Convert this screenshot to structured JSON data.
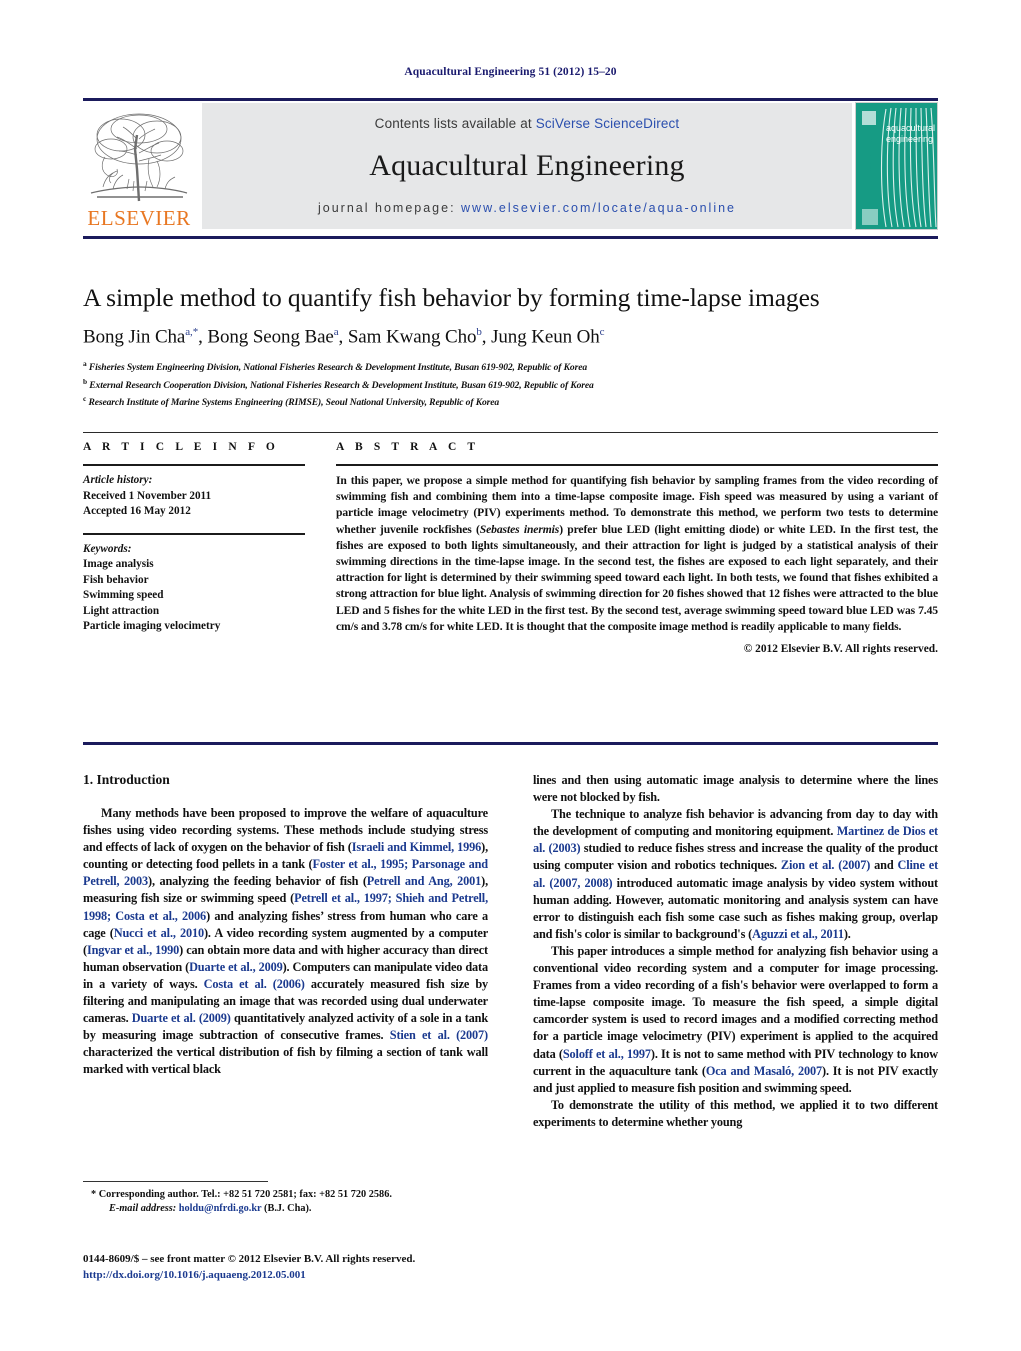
{
  "running_head": "Aquacultural Engineering 51 (2012) 15–20",
  "masthead": {
    "publisher_logo_text": "ELSEVIER",
    "contents_prefix": "Contents lists available at ",
    "contents_link": "SciVerse ScienceDirect",
    "journal_title": "Aquacultural Engineering",
    "homepage_prefix": "journal homepage: ",
    "homepage_url": "www.elsevier.com/locate/aqua-online",
    "cover_title_line1": "aquacultural",
    "cover_title_line2": "engineering",
    "cover_color": "#169b84",
    "link_color": "#2b4fae",
    "logo_color": "#e87722"
  },
  "article": {
    "title": "A simple method to quantify fish behavior by forming time-lapse images",
    "authors": [
      {
        "name": "Bong Jin Cha",
        "marks": "a,*"
      },
      {
        "name": "Bong Seong Bae",
        "marks": "a"
      },
      {
        "name": "Sam Kwang Cho",
        "marks": "b"
      },
      {
        "name": "Jung Keun Oh",
        "marks": "c"
      }
    ],
    "affiliations": [
      {
        "mark": "a",
        "text": "Fisheries System Engineering Division, National Fisheries Research & Development Institute, Busan 619-902, Republic of Korea"
      },
      {
        "mark": "b",
        "text": "External Research Cooperation Division, National Fisheries Research & Development Institute, Busan 619-902, Republic of Korea"
      },
      {
        "mark": "c",
        "text": "Research Institute of Marine Systems Engineering (RIMSE), Seoul National University, Republic of Korea"
      }
    ]
  },
  "article_info": {
    "heading": "A R T I C L E   I N F O",
    "history_label": "Article history:",
    "history": [
      "Received 1 November 2011",
      "Accepted 16 May 2012"
    ],
    "keywords_label": "Keywords:",
    "keywords": [
      "Image analysis",
      "Fish behavior",
      "Swimming speed",
      "Light attraction",
      "Particle imaging velocimetry"
    ]
  },
  "abstract": {
    "heading": "A B S T R A C T",
    "part1": "In this paper, we propose a simple method for quantifying fish behavior by sampling frames from the video recording of swimming fish and combining them into a time-lapse composite image. Fish speed was measured by using a variant of particle image velocimetry (PIV) experiments method. To demonstrate this method, we perform two tests to determine whether juvenile rockfishes (",
    "species": "Sebastes inermis",
    "part2": ") prefer blue LED (light emitting diode) or white LED. In the first test, the fishes are exposed to both lights simultaneously, and their attraction for light is judged by a statistical analysis of their swimming directions in the time-lapse image. In the second test, the fishes are exposed to each light separately, and their attraction for light is determined by their swimming speed toward each light. In both tests, we found that fishes exhibited a strong attraction for blue light. Analysis of swimming direction for 20 fishes showed that 12 fishes were attracted to the blue LED and 5 fishes for the white LED in the first test. By the second test, average swimming speed toward blue LED was 7.45 cm/s and 3.78 cm/s for white LED. It is thought that the composite image method is readily applicable to many fields.",
    "copyright": "© 2012 Elsevier B.V. All rights reserved."
  },
  "body": {
    "section_heading": "1.  Introduction",
    "left_paragraph_1": {
      "segments": [
        {
          "t": "Many methods have been proposed to improve the welfare of aquaculture fishes using video recording systems. These methods include studying stress and effects of lack of oxygen on the behavior of fish (",
          "ref": false
        },
        {
          "t": "Israeli and Kimmel, 1996",
          "ref": true
        },
        {
          "t": "), counting or detecting food pellets in a tank (",
          "ref": false
        },
        {
          "t": "Foster et al., 1995; Parsonage and Petrell, 2003",
          "ref": true
        },
        {
          "t": "), analyzing the feeding behavior of fish (",
          "ref": false
        },
        {
          "t": "Petrell and Ang, 2001",
          "ref": true
        },
        {
          "t": "), measuring fish size or swimming speed (",
          "ref": false
        },
        {
          "t": "Petrell et al., 1997; Shieh and Petrell, 1998; Costa et al., 2006",
          "ref": true
        },
        {
          "t": ") and analyzing fishes’ stress from human who care a cage (",
          "ref": false
        },
        {
          "t": "Nucci et al., 2010",
          "ref": true
        },
        {
          "t": "). A video recording system augmented by a computer (",
          "ref": false
        },
        {
          "t": "Ingvar et al., 1990",
          "ref": true
        },
        {
          "t": ") can obtain more data and with higher accuracy than direct human observation (",
          "ref": false
        },
        {
          "t": "Duarte et al., 2009",
          "ref": true
        },
        {
          "t": "). Computers can manipulate video data in a variety of ways. ",
          "ref": false
        },
        {
          "t": "Costa et al. (2006)",
          "ref": true
        },
        {
          "t": " accurately measured fish size by filtering and manipulating an image that was recorded using dual underwater cameras. ",
          "ref": false
        },
        {
          "t": "Duarte et al. (2009)",
          "ref": true
        },
        {
          "t": " quantitatively analyzed activity of a sole in a tank by measuring image subtraction of consecutive frames. ",
          "ref": false
        },
        {
          "t": "Stien et al. (2007)",
          "ref": true
        },
        {
          "t": " characterized the vertical distribution of fish by filming a section of tank wall marked with vertical black",
          "ref": false
        }
      ]
    },
    "right_paragraph_1": {
      "segments": [
        {
          "t": "lines and then using automatic image analysis to determine where the lines were not blocked by fish.",
          "ref": false
        }
      ]
    },
    "right_paragraph_2": {
      "segments": [
        {
          "t": "The technique to analyze fish behavior is advancing from day to day with the development of computing and monitoring equipment. ",
          "ref": false
        },
        {
          "t": "Martinez de Dios et al. (2003)",
          "ref": true
        },
        {
          "t": " studied to reduce fishes stress and increase the quality of the product using computer vision and robotics techniques. ",
          "ref": false
        },
        {
          "t": "Zion et al. (2007)",
          "ref": true
        },
        {
          "t": " and ",
          "ref": false
        },
        {
          "t": "Cline et al. (2007, 2008)",
          "ref": true
        },
        {
          "t": " introduced automatic image analysis by video system without human adding. However, automatic monitoring and analysis system can have error to distinguish each fish some case such as fishes making group, overlap and fish's color is similar to background's (",
          "ref": false
        },
        {
          "t": "Aguzzi et al., 2011",
          "ref": true
        },
        {
          "t": ").",
          "ref": false
        }
      ]
    },
    "right_paragraph_3": {
      "segments": [
        {
          "t": "This paper introduces a simple method for analyzing fish behavior using a conventional video recording system and a computer for image processing. Frames from a video recording of a fish's behavior were overlapped to form a time-lapse composite image. To measure the fish speed, a simple digital camcorder system is used to record images and a modified correcting method for a particle image velocimetry (PIV) experiment is applied to the acquired data (",
          "ref": false
        },
        {
          "t": "Soloff et al., 1997",
          "ref": true
        },
        {
          "t": "). It is not to same method with PIV technology to know current in the aquaculture tank (",
          "ref": false
        },
        {
          "t": "Oca and Masaló, 2007",
          "ref": true
        },
        {
          "t": "). It is not PIV exactly and just applied to measure fish position and swimming speed.",
          "ref": false
        }
      ]
    },
    "right_paragraph_4": {
      "segments": [
        {
          "t": "To demonstrate the utility of this method, we applied it to two different experiments to determine whether young",
          "ref": false
        }
      ]
    }
  },
  "footnote": {
    "corresponding": "* Corresponding author. Tel.: +82 51 720 2581; fax: +82 51 720 2586.",
    "email_label": "E-mail address:",
    "email": "holdu@nfrdi.go.kr",
    "email_suffix": "(B.J. Cha)."
  },
  "footer": {
    "issn_line": "0144-8609/$ – see front matter © 2012 Elsevier B.V. All rights reserved.",
    "doi": "http://dx.doi.org/10.1016/j.aquaeng.2012.05.001"
  }
}
